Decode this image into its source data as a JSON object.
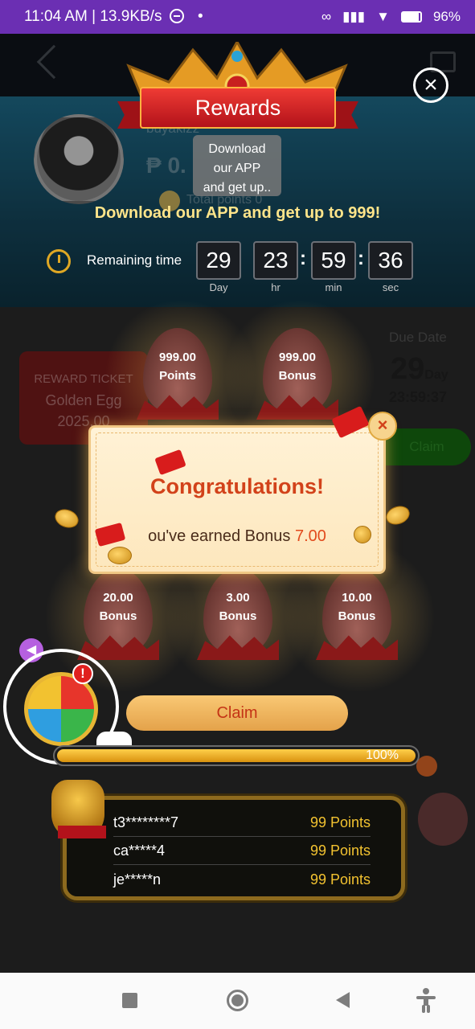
{
  "status_bar": {
    "time": "11:04 AM | 13.9KB/s",
    "dot": "•",
    "battery": "96%",
    "icons": [
      "minus-circle-icon",
      "link-icon",
      "signal-icon",
      "wifi-icon",
      "battery-icon"
    ]
  },
  "background": {
    "username": "buyakizz",
    "balance_prefix": "₱ 0.",
    "total_points_label": "Total points 0",
    "ticket": {
      "label": "REWARD TICKET",
      "name": "Golden Egg",
      "amount": "2025.00"
    },
    "due": {
      "label": "Due Date",
      "days": "29",
      "days_unit": "Day",
      "time": "23:59:37"
    },
    "claim_label": "Claim"
  },
  "rewards": {
    "title": "Rewards",
    "tooltip": [
      "Download",
      "our APP",
      "and get up.."
    ],
    "headline": "Download our APP and get up to 999!",
    "remaining_label": "Remaining time",
    "timer": [
      {
        "value": "29",
        "unit": "Day"
      },
      {
        "value": "23",
        "unit": "hr"
      },
      {
        "value": "59",
        "unit": "min"
      },
      {
        "value": "36",
        "unit": "sec"
      }
    ],
    "eggs": [
      {
        "value": "999.00",
        "kind": "Points"
      },
      {
        "value": "999.00",
        "kind": "Bonus"
      },
      {
        "value": "20.00",
        "kind": "Bonus"
      },
      {
        "value": "3.00",
        "kind": "Bonus"
      },
      {
        "value": "10.00",
        "kind": "Bonus"
      }
    ],
    "claim_label": "Claim",
    "progress": {
      "value": 1.0,
      "label": "100%"
    }
  },
  "modal": {
    "title": "Congratulations!",
    "message_prefix": "ou've earned Bonus ",
    "amount": "7.00",
    "close_symbol": "×"
  },
  "leaderboard": [
    {
      "user": "t3********7",
      "points": "99 Points"
    },
    {
      "user": "ca*****4",
      "points": "99 Points"
    },
    {
      "user": "je*****n",
      "points": "99 Points"
    }
  ],
  "game": {
    "alert": "!"
  },
  "colors": {
    "status_bar": "#6b2fb3",
    "accent_gold": "#f2c230",
    "ribbon_red": "#d81c1c"
  }
}
